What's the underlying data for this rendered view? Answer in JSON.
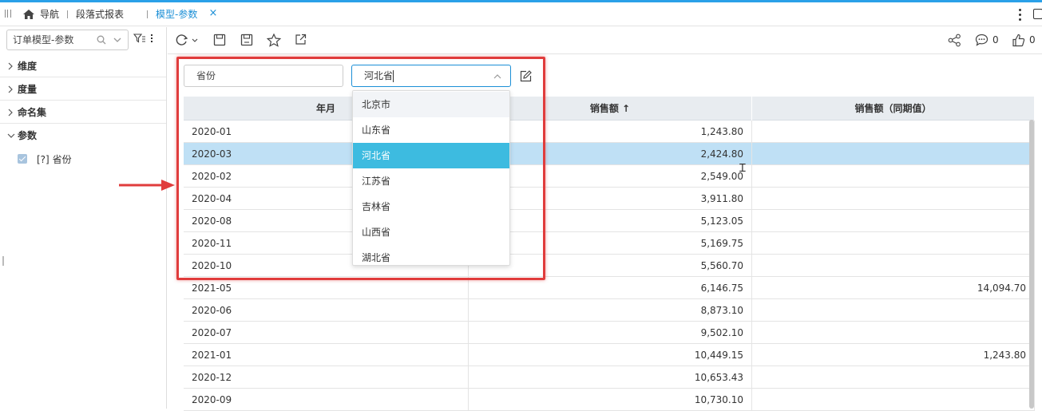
{
  "tabs": {
    "nav_label": "导航",
    "report_label": "段落式报表",
    "active_label": "模型-参数",
    "close_glyph": "×"
  },
  "left_panel": {
    "model_select_value": "订单模型-参数",
    "tree": [
      {
        "label": "维度",
        "expanded": false
      },
      {
        "label": "度量",
        "expanded": false
      },
      {
        "label": "命名集",
        "expanded": false
      },
      {
        "label": "参数",
        "expanded": true
      }
    ],
    "param_item": {
      "tag": "[?]",
      "label": "省份",
      "checked": true
    }
  },
  "toolbar": {
    "share_icon": "share-icon",
    "comment_count": "0",
    "like_count": "0"
  },
  "parameter_bar": {
    "name_label": "省份",
    "select_value": "河北省"
  },
  "dropdown": {
    "options": [
      "北京市",
      "山东省",
      "河北省",
      "江苏省",
      "吉林省",
      "山西省",
      "湖北省"
    ],
    "selected": "河北省",
    "hovered": "北京市"
  },
  "table": {
    "headers": [
      "年月",
      "销售额 ↑",
      "销售额（同期值）"
    ],
    "rows": [
      [
        "2020-01",
        "1,243.80",
        ""
      ],
      [
        "2020-03",
        "2,424.80",
        ""
      ],
      [
        "2020-02",
        "2,549.00",
        ""
      ],
      [
        "2020-04",
        "3,911.80",
        ""
      ],
      [
        "2020-08",
        "5,123.05",
        ""
      ],
      [
        "2020-11",
        "5,169.75",
        ""
      ],
      [
        "2020-10",
        "5,560.70",
        ""
      ],
      [
        "2021-05",
        "6,146.75",
        "14,094.70"
      ],
      [
        "2020-06",
        "8,873.10",
        ""
      ],
      [
        "2020-07",
        "9,502.10",
        ""
      ],
      [
        "2021-01",
        "10,449.15",
        "1,243.80"
      ],
      [
        "2020-12",
        "10,653.43",
        ""
      ],
      [
        "2020-09",
        "10,730.10",
        ""
      ]
    ],
    "selected_row": 1
  },
  "colors": {
    "accent": "#1b8fd6",
    "selected_option": "#3dbbe0",
    "selected_row": "#bfe0f5",
    "annotation_red": "#e03c3c"
  }
}
